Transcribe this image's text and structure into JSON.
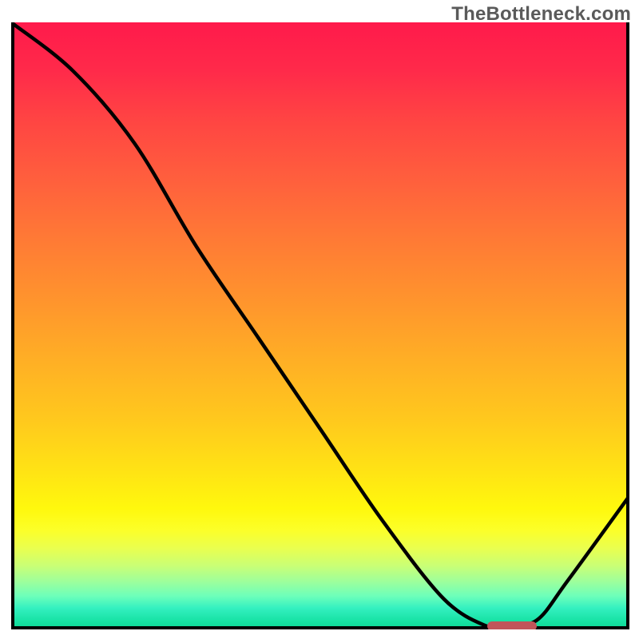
{
  "watermark": "TheBottleneck.com",
  "chart_data": {
    "type": "line",
    "title": "",
    "xlabel": "",
    "ylabel": "",
    "xlim": [
      0,
      100
    ],
    "ylim": [
      0,
      100
    ],
    "grid": false,
    "legend": false,
    "background_scale": {
      "orientation": "vertical",
      "meaning": "bottleneck-severity",
      "colors_top_to_bottom": [
        "#ff1a4b",
        "#ff7a35",
        "#ffe215",
        "#fcff28",
        "#10db9a"
      ]
    },
    "series": [
      {
        "name": "bottleneck-curve",
        "x": [
          0,
          10,
          20,
          30,
          40,
          50,
          60,
          70,
          77,
          80,
          85,
          90,
          100
        ],
        "y": [
          100,
          92,
          80,
          63,
          48,
          33,
          18,
          5,
          0.5,
          0.5,
          1.5,
          8,
          22
        ]
      }
    ],
    "optimal_marker": {
      "x_start": 77,
      "x_end": 85,
      "y": 0.5,
      "color": "#c1555a"
    }
  }
}
